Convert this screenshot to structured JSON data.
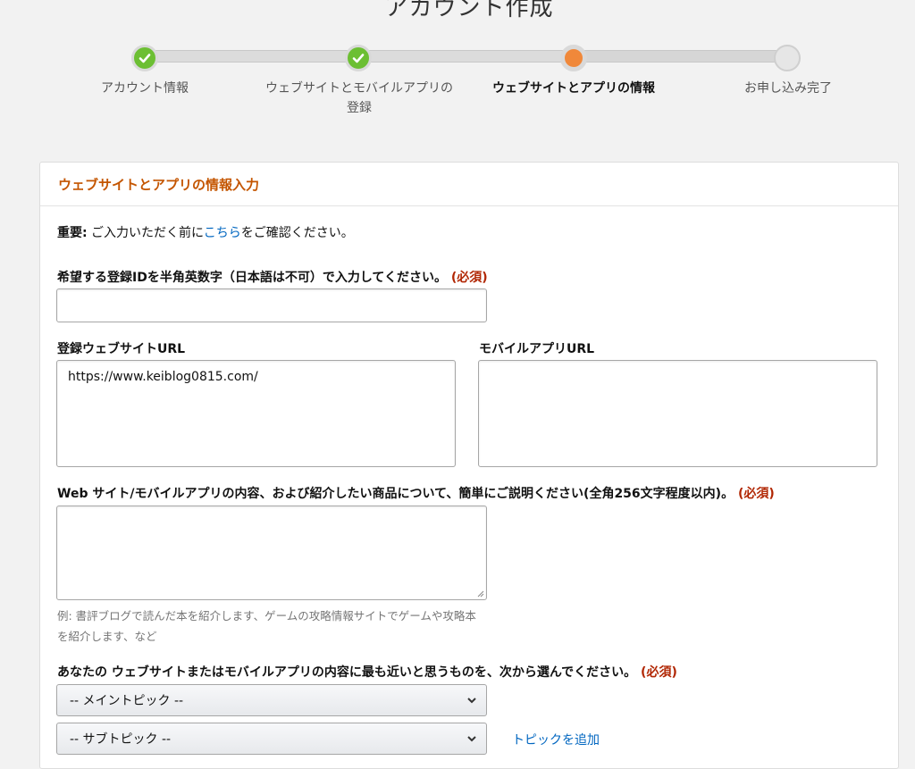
{
  "page": {
    "title": "アカウント作成"
  },
  "steps": [
    {
      "label": "アカウント情報",
      "state": "done"
    },
    {
      "label": "ウェブサイトとモバイルアプリの",
      "label2": "登録",
      "state": "done"
    },
    {
      "label": "ウェブサイトとアプリの情報",
      "state": "current"
    },
    {
      "label": "お申し込み完了",
      "state": "todo"
    }
  ],
  "colors": {
    "done": "#6cbf33",
    "current": "#f0883a",
    "heading": "#c45500",
    "required": "#b12704",
    "link": "#0066c0"
  },
  "form": {
    "heading": "ウェブサイトとアプリの情報入力",
    "notice": {
      "bold": "重要:",
      "before": " ご入力いただく前に",
      "link": "こちら",
      "after": "をご確認ください。"
    },
    "id_label": "希望する登録IDを半角英数字（日本語は不可）で入力してください。",
    "required": "(必須)",
    "id_value": "",
    "website_label": "登録ウェブサイトURL",
    "website_value": "https://www.keiblog0815.com/",
    "app_label": "モバイルアプリURL",
    "app_value": "",
    "description_label": "Web サイト/モバイルアプリの内容、および紹介したい商品について、簡単にご説明ください(全角256文字程度以内)。",
    "description_value": "",
    "description_hint": "例: 書評ブログで読んだ本を紹介します、ゲームの攻略情報サイトでゲームや攻略本を紹介します、など",
    "topic_label": "あなたの ウェブサイトまたはモバイルアプリの内容に最も近いと思うものを、次から選んでください。",
    "main_topic": "-- メイントピック --",
    "sub_topic": "-- サブトピック --",
    "add_topic": "トピックを追加"
  }
}
